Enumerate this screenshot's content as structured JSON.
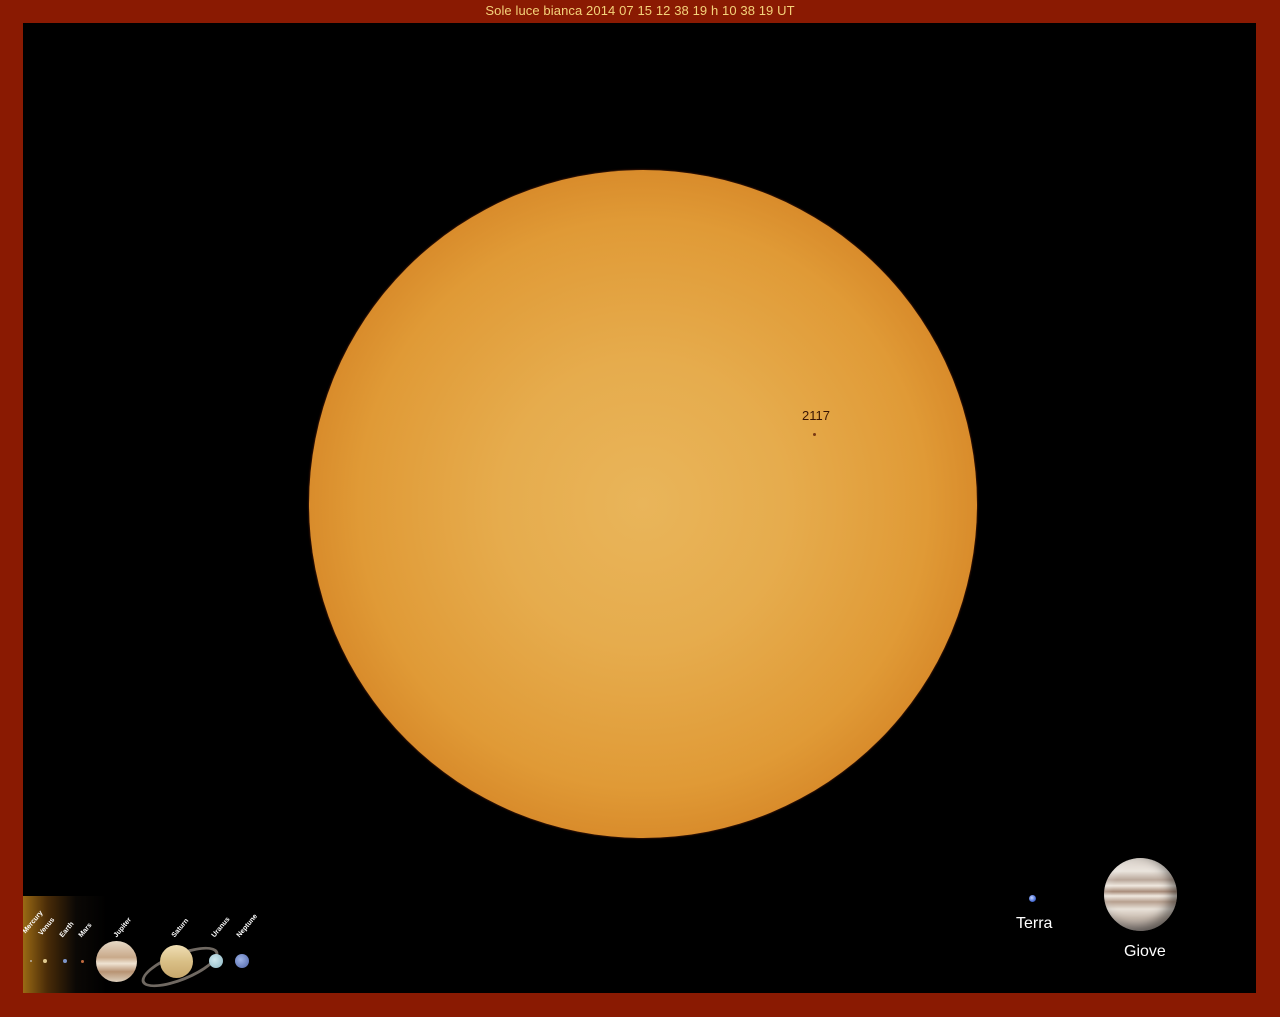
{
  "title": "Sole luce bianca  2014 07 15 12 38 19 h 10 38 19 UT",
  "sun": {
    "region_label": "2117"
  },
  "comparison": {
    "earth_label": "Terra",
    "jupiter_label": "Giove"
  },
  "inset": {
    "planets": [
      "Mercury",
      "Venus",
      "Earth",
      "Mars",
      "Jupiter",
      "Saturn",
      "Uranus",
      "Neptune"
    ]
  },
  "colors": {
    "frame": "#8a1a02",
    "title_text": "#f4d27a",
    "sun_core": "#e9b55a",
    "sun_limb": "#8f300a",
    "space": "#000000"
  }
}
